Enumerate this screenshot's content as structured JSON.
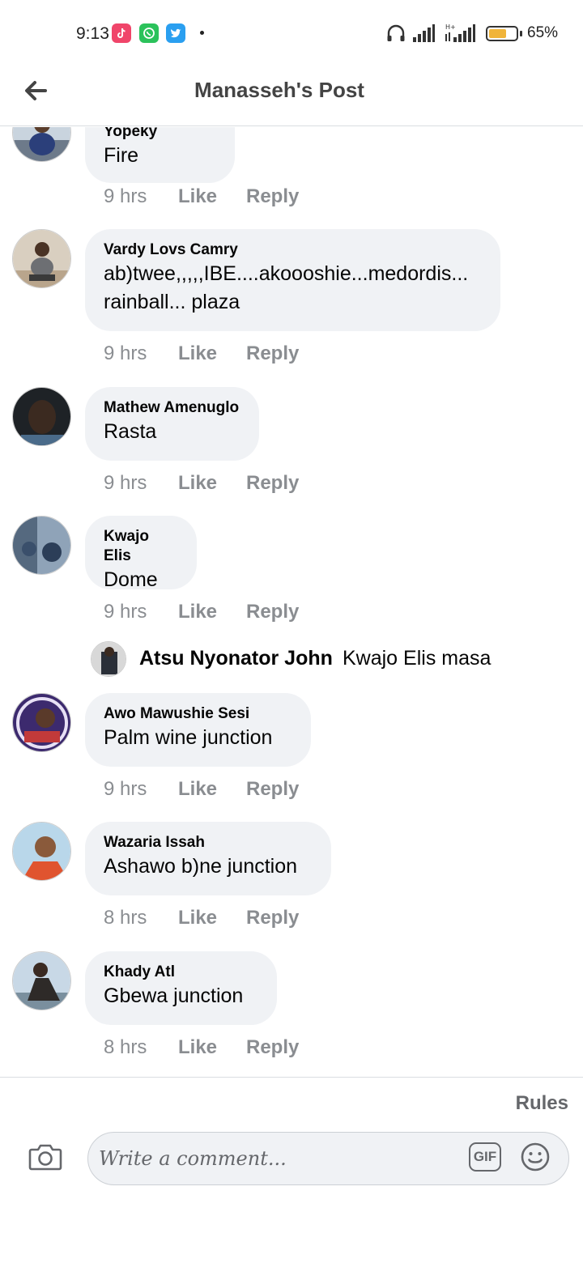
{
  "status_bar": {
    "time": "9:13",
    "battery": "65%",
    "battery_level": 0.65,
    "icons": [
      "tiktok-icon",
      "whatsapp-icon",
      "twitter-icon",
      "headphones-icon",
      "signal-icon",
      "signal-hplus-icon",
      "battery-icon"
    ]
  },
  "header": {
    "title": "Manasseh's Post",
    "back_icon": "arrow-left-icon"
  },
  "comments": [
    {
      "name": "Samuel Yopeky",
      "text": "Fire",
      "time": "9 hrs",
      "like": "Like",
      "reply": "Reply"
    },
    {
      "name": "Vardy Lovs Camry",
      "text_lines": [
        "ab)twee,,,,,IBE....akoooshie...medordis...",
        "rainball... plaza"
      ],
      "time": "9 hrs",
      "like": "Like",
      "reply": "Reply"
    },
    {
      "name": "Mathew Amenuglo",
      "text": "Rasta",
      "time": "9 hrs",
      "like": "Like",
      "reply": "Reply"
    },
    {
      "name": "Kwajo Elis",
      "text": "Dome",
      "time": "9 hrs",
      "like": "Like",
      "reply": "Reply",
      "reply_preview": {
        "name": "Atsu Nyonator John",
        "text": "Kwajo Elis masa"
      }
    },
    {
      "name": "Awo Mawushie Sesi",
      "text": "Palm wine junction",
      "time": "9 hrs",
      "like": "Like",
      "reply": "Reply"
    },
    {
      "name": "Wazaria Issah",
      "text": "Ashawo b)ne junction",
      "time": "8 hrs",
      "like": "Like",
      "reply": "Reply"
    },
    {
      "name": "Khady Atl",
      "text": "Gbewa junction",
      "time": "8 hrs",
      "like": "Like",
      "reply": "Reply"
    }
  ],
  "composer": {
    "rules": "Rules",
    "placeholder": "Write a comment...",
    "gif": "GIF",
    "camera_icon": "camera-icon",
    "emoji_icon": "emoji-icon"
  },
  "colors": {
    "bubble": "#f0f2f5",
    "meta_text": "#8a8d91",
    "header_text": "#444444"
  }
}
